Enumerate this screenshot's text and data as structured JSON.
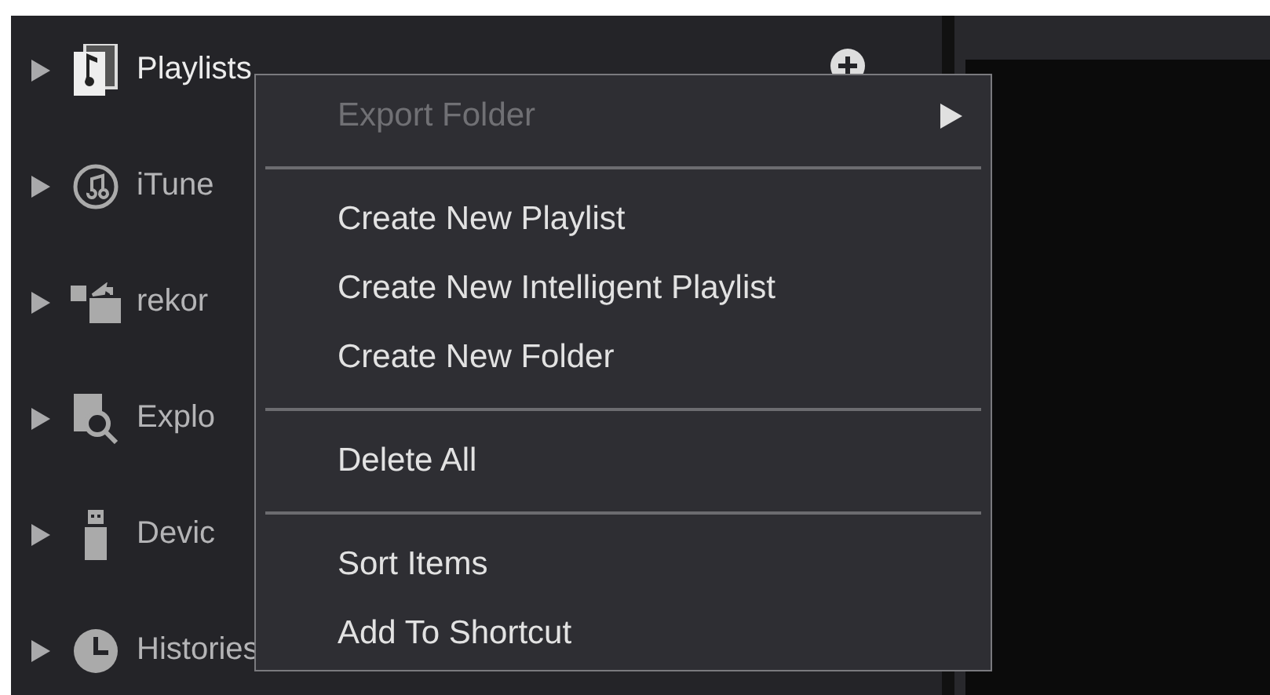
{
  "sidebar": {
    "items": [
      {
        "label": "Playlists",
        "selected": true,
        "add_button": true
      },
      {
        "label": "iTune",
        "selected": false,
        "add_button": false
      },
      {
        "label": "rekor",
        "selected": false,
        "add_button": false
      },
      {
        "label": "Explo",
        "selected": false,
        "add_button": false
      },
      {
        "label": "Devic",
        "selected": false,
        "add_button": false
      },
      {
        "label": "Histories",
        "selected": false,
        "add_button": false
      }
    ]
  },
  "context_menu": {
    "items": [
      {
        "kind": "item",
        "label": "Export Folder",
        "disabled": true,
        "submenu": true
      },
      {
        "kind": "separator"
      },
      {
        "kind": "item",
        "label": "Create New Playlist",
        "disabled": false,
        "submenu": false
      },
      {
        "kind": "item",
        "label": "Create New Intelligent Playlist",
        "disabled": false,
        "submenu": false
      },
      {
        "kind": "item",
        "label": "Create New Folder",
        "disabled": false,
        "submenu": false
      },
      {
        "kind": "separator"
      },
      {
        "kind": "item",
        "label": "Delete All",
        "disabled": false,
        "submenu": false
      },
      {
        "kind": "separator"
      },
      {
        "kind": "item",
        "label": "Sort Items",
        "disabled": false,
        "submenu": false
      },
      {
        "kind": "item",
        "label": "Add To Shortcut",
        "disabled": false,
        "submenu": false
      }
    ]
  }
}
